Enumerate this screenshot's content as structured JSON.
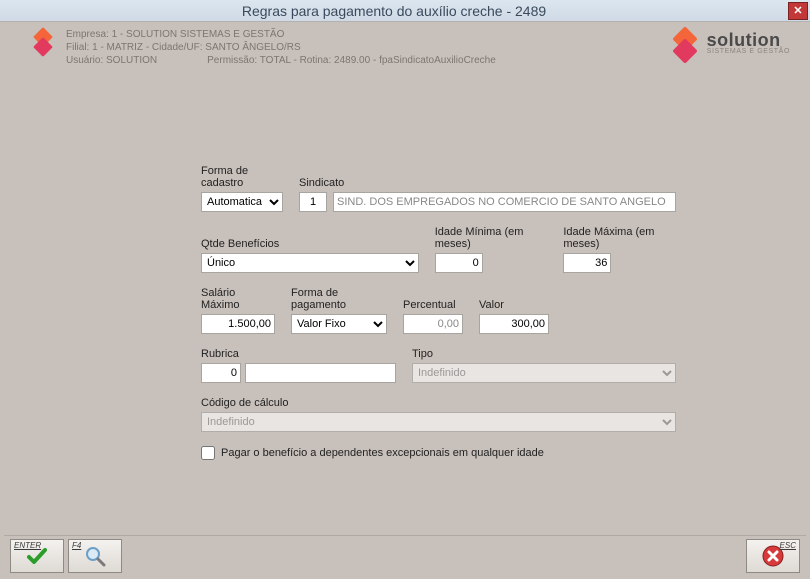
{
  "window": {
    "title": "Regras para pagamento do auxílio creche - 2489"
  },
  "header": {
    "empresa": "Empresa: 1 - SOLUTION SISTEMAS E GESTÃO",
    "filial": "Filial: 1 - MATRIZ - Cidade/UF: SANTO ÂNGELO/RS",
    "usuario": "Usuário: SOLUTION",
    "permissao": "Permissão: TOTAL - Rotina: 2489.00 - fpaSindicatoAuxilioCreche",
    "brand": "solution",
    "brand_sub": "SISTEMAS E GESTÃO"
  },
  "labels": {
    "forma_cadastro": "Forma de cadastro",
    "sindicato": "Sindicato",
    "qtde_beneficios": "Qtde Benefícios",
    "idade_min": "Idade Mínima (em meses)",
    "idade_max": "Idade Máxima (em meses)",
    "salario_max": "Salário Máximo",
    "forma_pagamento": "Forma de pagamento",
    "percentual": "Percentual",
    "valor": "Valor",
    "rubrica": "Rubrica",
    "tipo": "Tipo",
    "codigo_calculo": "Código de cálculo",
    "checkbox": "Pagar o benefício a dependentes excepcionais em qualquer idade"
  },
  "values": {
    "forma_cadastro": "Automatica",
    "sindicato_cod": "1",
    "sindicato_nome": "SIND. DOS EMPREGADOS NO COMERCIO DE SANTO ANGELO",
    "qtde_beneficios": "Único",
    "idade_min": "0",
    "idade_max": "36",
    "salario_max": "1.500,00",
    "forma_pagamento": "Valor Fixo",
    "percentual": "0,00",
    "valor": "300,00",
    "rubrica_cod": "0",
    "rubrica_nome": "",
    "tipo": "Indefinido",
    "codigo_calculo": "Indefinido",
    "pagar_excepcionais": false
  },
  "buttons": {
    "enter": "ENTER",
    "f4": "F4",
    "esc": "ESC"
  }
}
